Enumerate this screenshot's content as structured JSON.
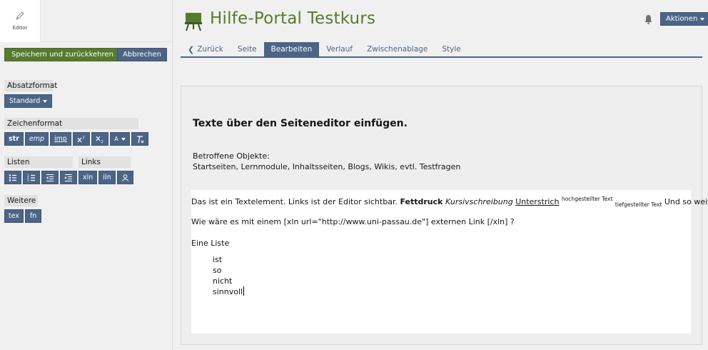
{
  "left": {
    "editor_label": "Editor",
    "save_label": "Speichern und zurückkehren",
    "cancel_label": "Abbrechen",
    "absatz": {
      "label": "Absatzformat",
      "select": "Standard"
    },
    "zeichen": {
      "label": "Zeichenformat",
      "str": "str",
      "emp": "emp",
      "imp": "imp",
      "a_label": "A"
    },
    "listen": {
      "label": "Listen"
    },
    "links": {
      "label": "Links",
      "xln": "xln",
      "iln": "iln"
    },
    "weitere": {
      "label": "Weitere",
      "tex": "tex",
      "fn": "fn"
    }
  },
  "header": {
    "title": "Hilfe-Portal Testkurs",
    "actions_label": "Aktionen"
  },
  "tabs": [
    {
      "label": "Zurück"
    },
    {
      "label": "Seite"
    },
    {
      "label": "Bearbeiten"
    },
    {
      "label": "Verlauf"
    },
    {
      "label": "Zwischenablage"
    },
    {
      "label": "Style"
    }
  ],
  "content": {
    "heading": "Texte über den Seiteneditor einfügen.",
    "objects_line1": "Betroffene Objekte:",
    "objects_line2": "Startseiten, Lernmodule, Inhaltsseiten, Blogs, Wikis, evtl. Testfragen",
    "p1_plain": "Das ist ein Textelement. Links ist der Editor sichtbar. ",
    "p1_bold": "Fettdruck",
    "p1_italic": "Kursivschreibung",
    "p1_underline": "Unterstrich",
    "p1_sup": "hochgestellter Text",
    "p1_sub": "tiefgestellter Text",
    "p1_end": " Und so weiter...",
    "p2": "Wie wäre es mit einem [xln url=\"http://www.uni-passau.de\"] externen Link [/xln] ?",
    "p3": "Eine Liste",
    "list": [
      "ist",
      "so",
      "nicht",
      "sinnvoll"
    ]
  },
  "colors": {
    "green": "#557b2e",
    "blue": "#4c6586"
  }
}
